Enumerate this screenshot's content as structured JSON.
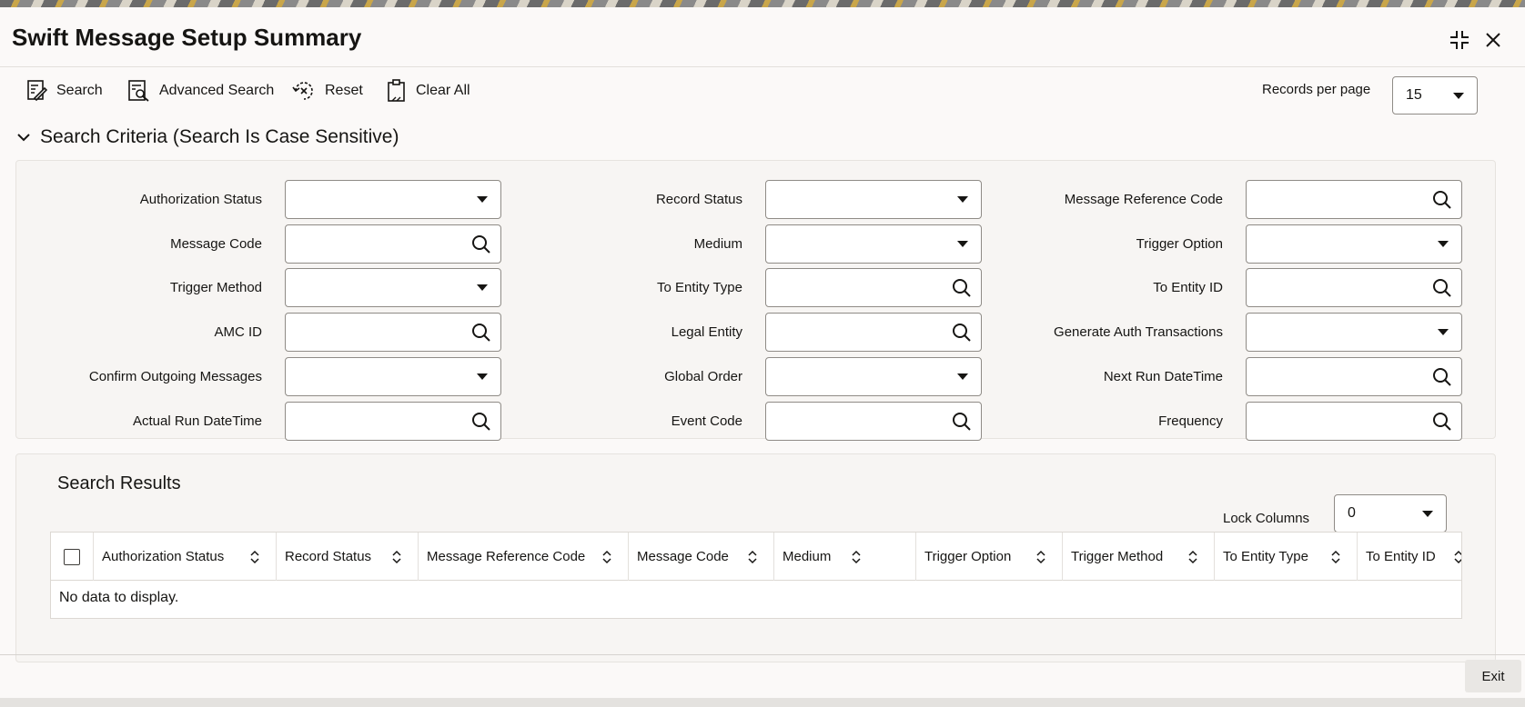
{
  "window": {
    "title": "Swift Message Setup Summary"
  },
  "toolbar": {
    "search_label": "Search",
    "advanced_search_label": "Advanced Search",
    "reset_label": "Reset",
    "clear_all_label": "Clear All",
    "records_per_page_label": "Records per page",
    "records_per_page_value": "15"
  },
  "criteria": {
    "header": "Search Criteria (Search Is Case Sensitive)",
    "fields": {
      "authorization_status": {
        "label": "Authorization Status",
        "value": "",
        "kind": "select"
      },
      "record_status": {
        "label": "Record Status",
        "value": "",
        "kind": "select"
      },
      "message_reference_code": {
        "label": "Message Reference Code",
        "value": "",
        "kind": "lookup"
      },
      "message_code": {
        "label": "Message Code",
        "value": "",
        "kind": "lookup"
      },
      "medium": {
        "label": "Medium",
        "value": "",
        "kind": "select"
      },
      "trigger_option": {
        "label": "Trigger Option",
        "value": "",
        "kind": "select"
      },
      "trigger_method": {
        "label": "Trigger Method",
        "value": "",
        "kind": "select"
      },
      "to_entity_type": {
        "label": "To Entity Type",
        "value": "",
        "kind": "lookup"
      },
      "to_entity_id": {
        "label": "To Entity ID",
        "value": "",
        "kind": "lookup"
      },
      "amc_id": {
        "label": "AMC ID",
        "value": "",
        "kind": "lookup"
      },
      "legal_entity": {
        "label": "Legal Entity",
        "value": "",
        "kind": "lookup"
      },
      "generate_auth_transactions": {
        "label": "Generate Auth Transactions",
        "value": "",
        "kind": "select"
      },
      "confirm_outgoing_messages": {
        "label": "Confirm Outgoing Messages",
        "value": "",
        "kind": "select"
      },
      "global_order": {
        "label": "Global Order",
        "value": "",
        "kind": "select"
      },
      "next_run_datetime": {
        "label": "Next Run DateTime",
        "value": "",
        "kind": "lookup"
      },
      "actual_run_datetime": {
        "label": "Actual Run DateTime",
        "value": "",
        "kind": "lookup"
      },
      "event_code": {
        "label": "Event Code",
        "value": "",
        "kind": "lookup"
      },
      "frequency": {
        "label": "Frequency",
        "value": "",
        "kind": "lookup"
      }
    }
  },
  "results": {
    "title": "Search Results",
    "lock_columns_label": "Lock Columns",
    "lock_columns_value": "0",
    "columns": [
      "Authorization Status",
      "Record Status",
      "Message Reference Code",
      "Message Code",
      "Medium",
      "Trigger Option",
      "Trigger Method",
      "To Entity Type",
      "To Entity ID"
    ],
    "empty_message": "No data to display."
  },
  "footer": {
    "exit_label": "Exit"
  },
  "colors": {
    "text": "#161513",
    "panel": "#f7f5f3",
    "border": "#8f8b86"
  },
  "icons": [
    "search-icon",
    "advanced-search-icon",
    "reset-icon",
    "clear-all-icon",
    "minimize-icon",
    "close-icon",
    "chevron-down-icon",
    "sort-icon",
    "dropdown-caret-icon"
  ]
}
